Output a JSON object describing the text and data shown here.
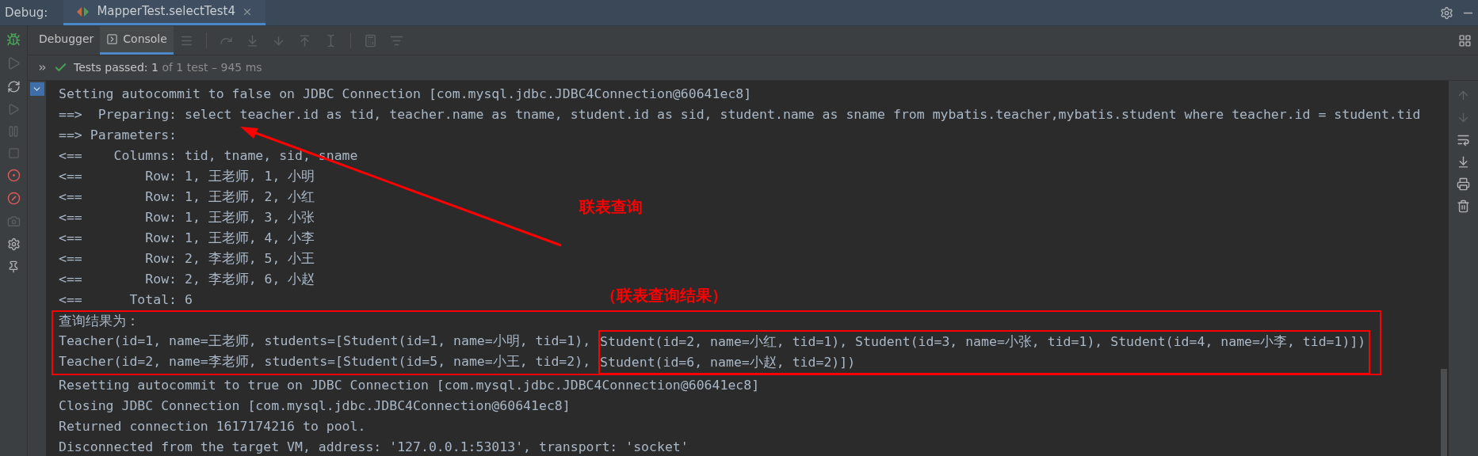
{
  "window": {
    "title": "Debug:"
  },
  "tabs": [
    {
      "label": "MapperTest.selectTest4",
      "selected": true
    }
  ],
  "toolbar": {
    "tabs": [
      {
        "label": "Debugger",
        "selected": false
      },
      {
        "label": "Console",
        "selected": true
      }
    ]
  },
  "test_status": {
    "passed_label": "Tests passed:",
    "passed_count": "1",
    "detail": "of 1 test – 945 ms"
  },
  "console": {
    "lines_before": [
      "Setting autocommit to false on JDBC Connection [com.mysql.jdbc.JDBC4Connection@60641ec8]",
      "==>  Preparing: select teacher.id as tid, teacher.name as tname, student.id as sid, student.name as sname from mybatis.teacher,mybatis.student where teacher.id = student.tid",
      "==> Parameters: ",
      "<==    Columns: tid, tname, sid, sname",
      "<==        Row: 1, 王老师, 1, 小明",
      "<==        Row: 1, 王老师, 2, 小红",
      "<==        Row: 1, 王老师, 3, 小张",
      "<==        Row: 1, 王老师, 4, 小李",
      "<==        Row: 2, 李老师, 5, 小王",
      "<==        Row: 2, 李老师, 6, 小赵",
      "<==      Total: 6"
    ],
    "result_header": "查询结果为：",
    "result_rows": [
      {
        "text": "Teacher(id=1, name=王老师, students=[Student(id=1, name=小明, tid=1), ",
        "boxed_text": "Student(id=2, name=小红, tid=1), Student(id=3, name=小张, tid=1), Student(id=4, name=小李, tid=1)])"
      },
      {
        "text": "Teacher(id=2, name=李老师, students=[Student(id=5, name=小王, tid=2), ",
        "boxed_text": "Student(id=6, name=小赵, tid=2)])"
      }
    ],
    "lines_after": [
      "Resetting autocommit to true on JDBC Connection [com.mysql.jdbc.JDBC4Connection@60641ec8]",
      "Closing JDBC Connection [com.mysql.jdbc.JDBC4Connection@60641ec8]",
      "Returned connection 1617174216 to pool.",
      "Disconnected from the target VM, address: '127.0.0.1:53013', transport: 'socket'"
    ]
  },
  "annotations": [
    {
      "kind": "arrow",
      "text": "联表查询"
    },
    {
      "kind": "label",
      "text": "（联表查询结果）"
    }
  ]
}
